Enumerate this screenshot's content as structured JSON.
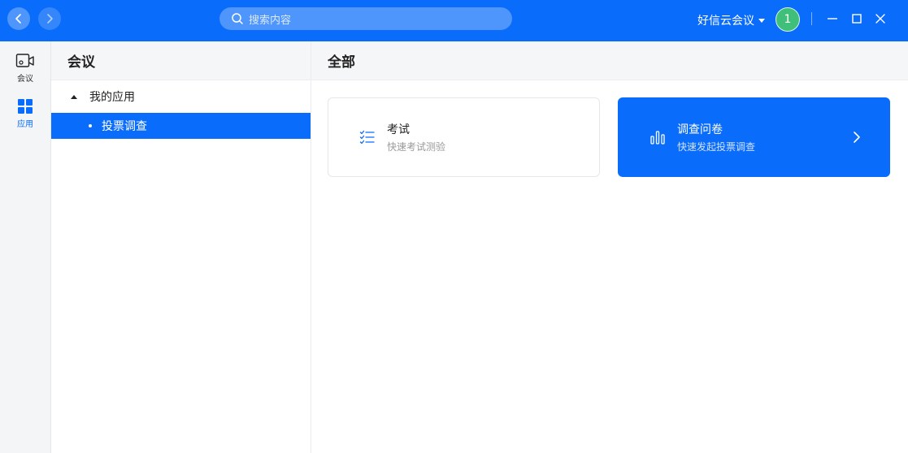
{
  "search": {
    "placeholder": "搜索内容"
  },
  "account": {
    "name": "好信云会议",
    "avatar_initial": "1"
  },
  "rail": {
    "items": [
      {
        "label": "会议",
        "icon": "video-camera-icon"
      },
      {
        "label": "应用",
        "icon": "apps-grid-icon"
      }
    ]
  },
  "tree": {
    "title": "会议",
    "group_label": "我的应用",
    "child_label": "投票调查"
  },
  "main": {
    "title": "全部",
    "cards": [
      {
        "title": "考试",
        "subtitle": "快速考试测验",
        "icon": "checklist-icon"
      },
      {
        "title": "调查问卷",
        "subtitle": "快速发起投票调查",
        "icon": "bar-chart-icon"
      }
    ]
  },
  "colors": {
    "accent": "#0a6cfb",
    "avatar": "#3fbf7a"
  }
}
